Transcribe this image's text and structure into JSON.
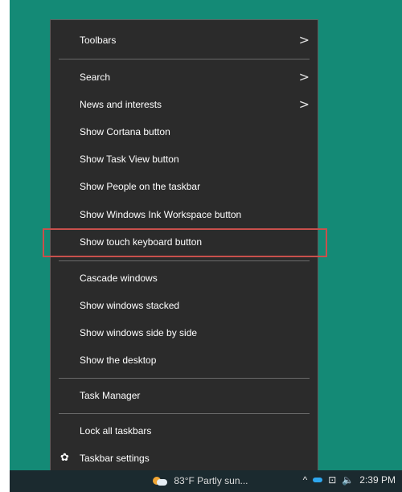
{
  "menu": {
    "items": [
      {
        "label": "Toolbars",
        "submenu": true
      },
      {
        "label": "Search",
        "submenu": true
      },
      {
        "label": "News and interests",
        "submenu": true
      },
      {
        "label": "Show Cortana button"
      },
      {
        "label": "Show Task View button"
      },
      {
        "label": "Show People on the taskbar"
      },
      {
        "label": "Show Windows Ink Workspace button"
      },
      {
        "label": "Show touch keyboard button"
      },
      {
        "label": "Cascade windows"
      },
      {
        "label": "Show windows stacked"
      },
      {
        "label": "Show windows side by side"
      },
      {
        "label": "Show the desktop"
      },
      {
        "label": "Task Manager"
      },
      {
        "label": "Lock all taskbars"
      },
      {
        "label": "Taskbar settings",
        "icon": "gear-icon"
      }
    ],
    "chevron": ">",
    "gear": "✿"
  },
  "taskbar": {
    "weather_text": "83°F  Partly sun...",
    "tray_chevron": "^",
    "network_icon": "⊡",
    "speaker_icon": "🔈",
    "time": "2:39 PM"
  },
  "colors": {
    "desktop": "#148a76",
    "menu_bg": "#2b2b2b",
    "highlight_border": "#c9504c",
    "taskbar": "#1b2a2f"
  }
}
